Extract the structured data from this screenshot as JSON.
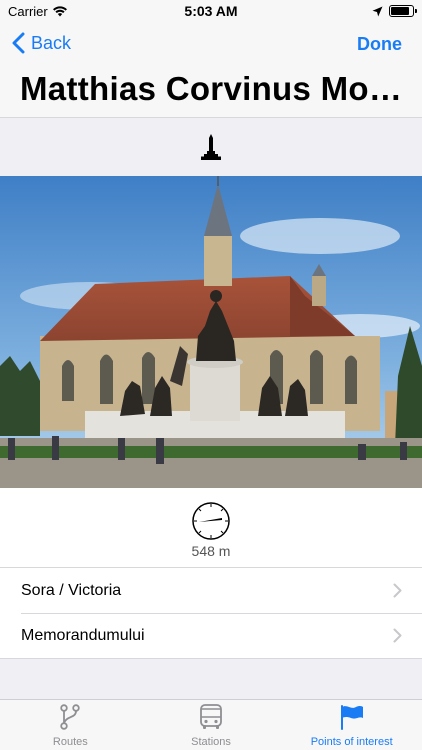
{
  "status_bar": {
    "carrier": "Carrier",
    "time": "5:03 AM",
    "battery_level": 0.85
  },
  "nav": {
    "back_label": "Back",
    "done_label": "Done",
    "title": "Matthias Corvinus Mo…"
  },
  "poi": {
    "type_icon": "monument-icon",
    "photo_subject": "statue-and-church-photo",
    "distance": "548 m"
  },
  "list": {
    "items": [
      {
        "label": "Sora / Victoria"
      },
      {
        "label": "Memorandumului"
      }
    ]
  },
  "tabs": [
    {
      "label": "Routes",
      "icon": "route-icon",
      "active": false
    },
    {
      "label": "Stations",
      "icon": "bus-icon",
      "active": false
    },
    {
      "label": "Points of interest",
      "icon": "flag-icon",
      "active": true
    }
  ],
  "colors": {
    "accent": "#1a7cf5",
    "inactive": "#8e8e93",
    "background": "#efeff4"
  }
}
